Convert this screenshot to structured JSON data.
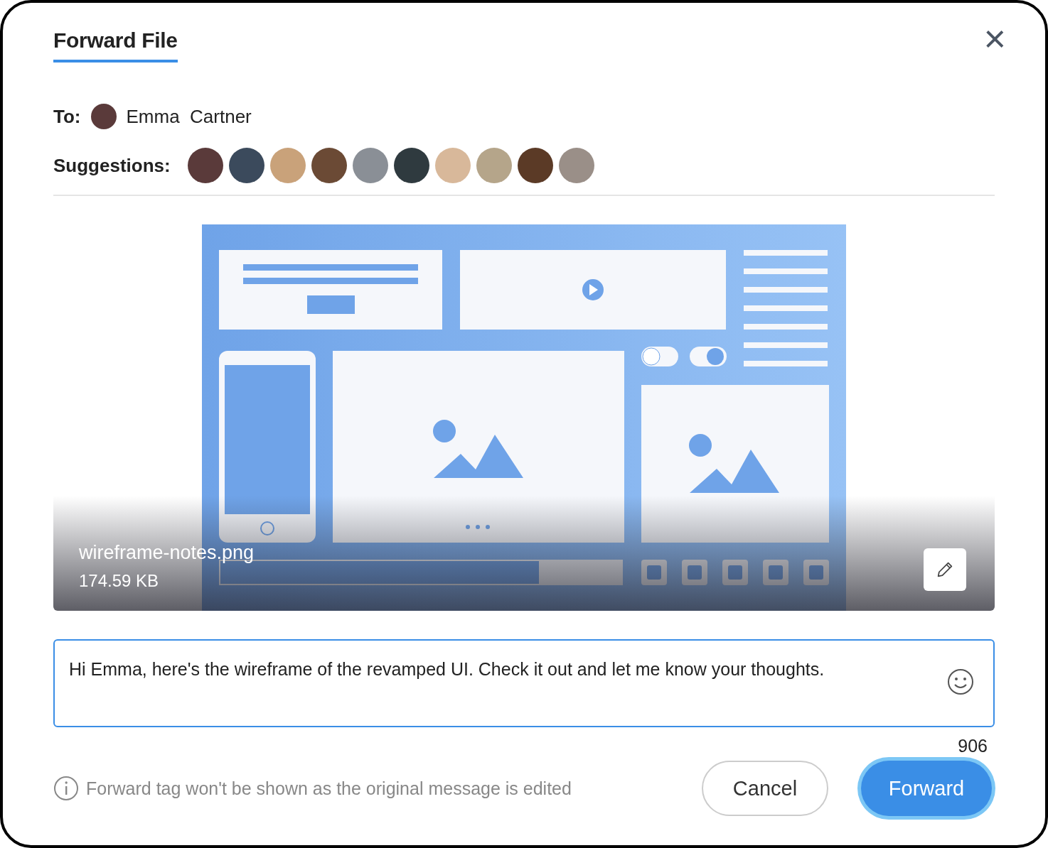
{
  "dialog": {
    "title": "Forward File",
    "close": "×"
  },
  "to": {
    "label": "To:",
    "recipient": "Emma  Cartner"
  },
  "suggestions": {
    "label": "Suggestions:"
  },
  "attachment": {
    "filename": "wireframe-notes.png",
    "size": "174.59 KB"
  },
  "message": {
    "value": "Hi Emma, here's the wireframe of the revamped UI. Check it out and let me know your thoughts.",
    "counter": "906"
  },
  "footer": {
    "note": "Forward tag won't be shown as the original message is edited",
    "buttons": [
      {
        "label": "Cancel",
        "kind": "secondary"
      },
      {
        "label": "Forward",
        "kind": "primary"
      }
    ]
  }
}
